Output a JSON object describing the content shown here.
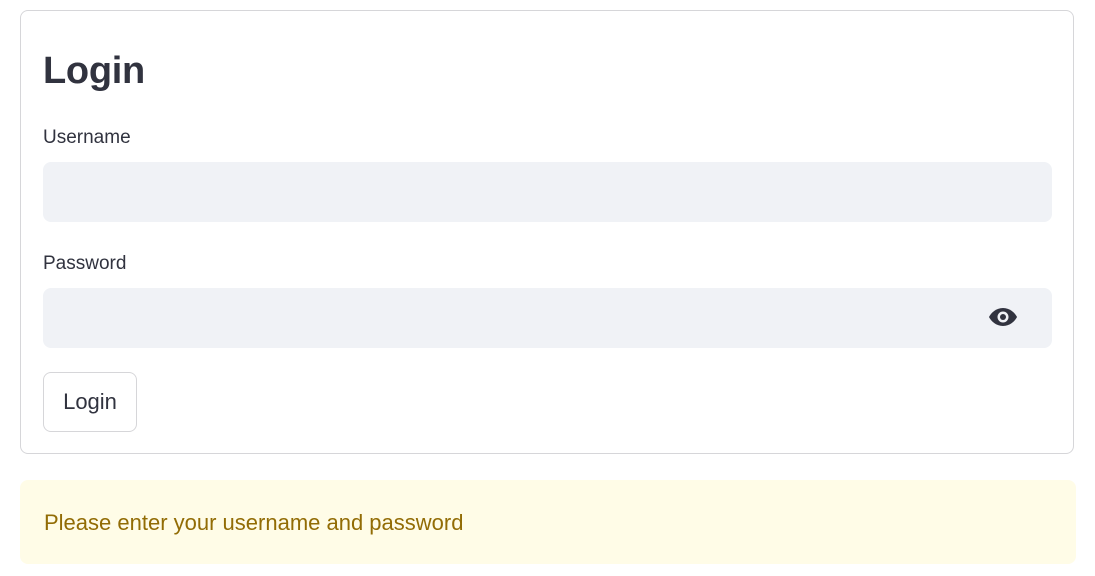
{
  "form": {
    "title": "Login",
    "username": {
      "label": "Username",
      "value": "",
      "placeholder": ""
    },
    "password": {
      "label": "Password",
      "value": "",
      "placeholder": "",
      "toggle_icon": "eye-icon"
    },
    "submit_label": "Login"
  },
  "alert": {
    "type": "warning",
    "message": "Please enter your username and password",
    "background_color": "#fffce7",
    "text_color": "#926c05"
  }
}
